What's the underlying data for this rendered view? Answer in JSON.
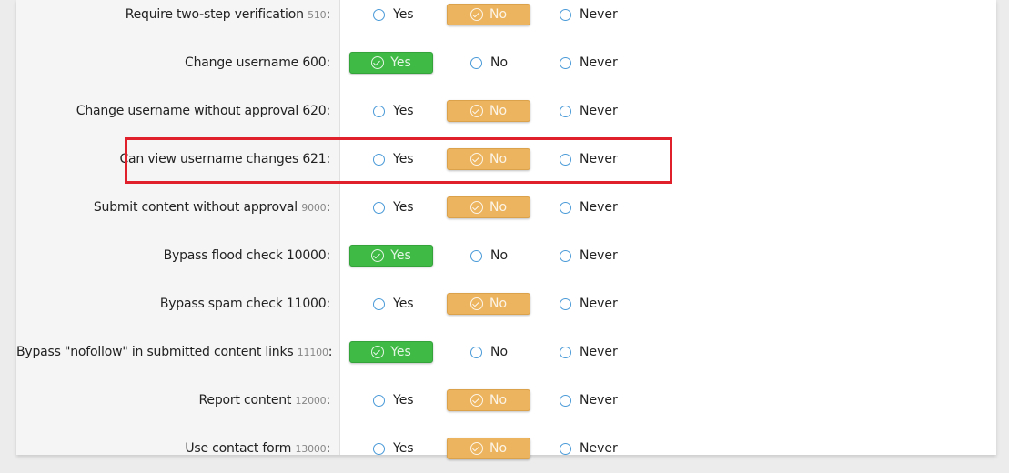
{
  "options": [
    "Yes",
    "No",
    "Never"
  ],
  "colors": {
    "yes_selected": "#3fba45",
    "no_selected": "#ecb45e",
    "radio": "#4a9ad8",
    "highlight": "#e0202a"
  },
  "highlighted_row": 3,
  "permissions": [
    {
      "label": "Require two-step verification",
      "id": "510",
      "id_small": true,
      "selected": "No"
    },
    {
      "label": "Change username",
      "id": "600",
      "id_small": false,
      "selected": "Yes"
    },
    {
      "label": "Change username without approval",
      "id": "620",
      "id_small": false,
      "selected": "No"
    },
    {
      "label": "Can view username changes",
      "id": "621",
      "id_small": false,
      "selected": "No"
    },
    {
      "label": "Submit content without approval",
      "id": "9000",
      "id_small": true,
      "selected": "No"
    },
    {
      "label": "Bypass flood check",
      "id": "10000",
      "id_small": false,
      "selected": "Yes"
    },
    {
      "label": "Bypass spam check",
      "id": "11000",
      "id_small": false,
      "selected": "No"
    },
    {
      "label": "Bypass \"nofollow\" in submitted content links",
      "id": "11100",
      "id_small": true,
      "selected": "Yes"
    },
    {
      "label": "Report content",
      "id": "12000",
      "id_small": true,
      "selected": "No"
    },
    {
      "label": "Use contact form",
      "id": "13000",
      "id_small": true,
      "selected": "No"
    }
  ]
}
